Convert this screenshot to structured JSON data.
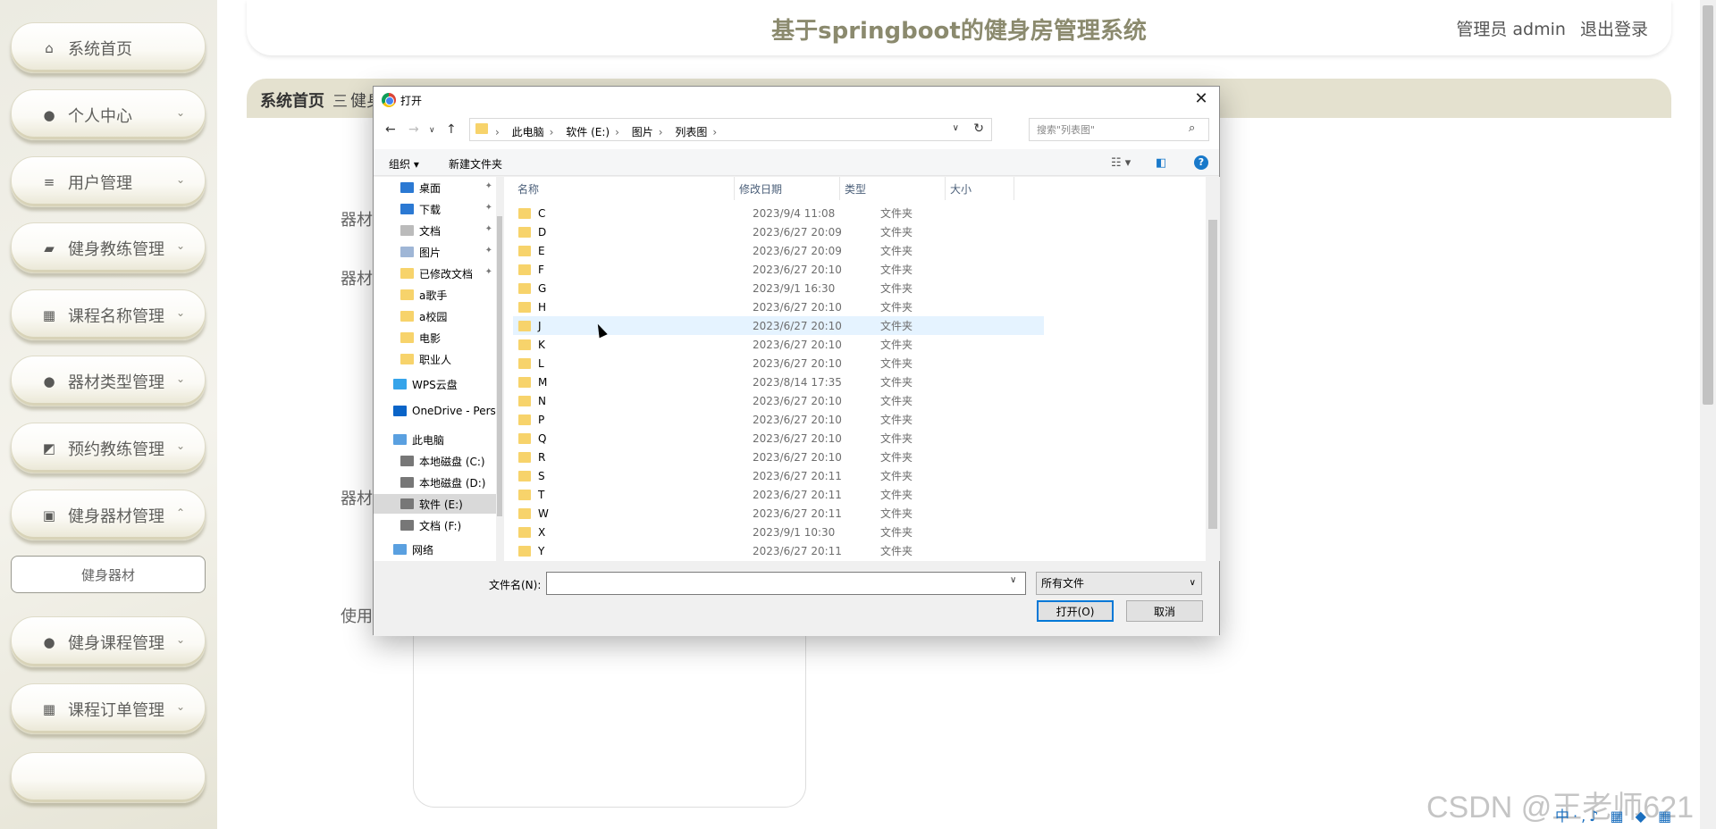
{
  "header": {
    "title": "基于springboot的健身房管理系统",
    "user": "管理员 admin",
    "logout": "退出登录"
  },
  "breadcrumb": {
    "home": "系统首页",
    "separator": "三",
    "current": "健身"
  },
  "sidebar": {
    "items": [
      {
        "label": "系统首页",
        "icon": "home-icon"
      },
      {
        "label": "个人中心",
        "icon": "user-icon"
      },
      {
        "label": "用户管理",
        "icon": "list-icon"
      },
      {
        "label": "健身教练管理",
        "icon": "briefcase-icon"
      },
      {
        "label": "课程名称管理",
        "icon": "grid-icon"
      },
      {
        "label": "器材类型管理",
        "icon": "user-icon"
      },
      {
        "label": "预约教练管理",
        "icon": "chart-icon"
      },
      {
        "label": "健身器材管理",
        "icon": "clipboard-icon"
      },
      {
        "label": "健身器材",
        "icon": ""
      },
      {
        "label": "健身课程管理",
        "icon": "bulb-icon"
      },
      {
        "label": "课程订单管理",
        "icon": "apps-icon"
      }
    ]
  },
  "form": {
    "label1": "器材",
    "label2": "器材",
    "label3": "器材",
    "label4": "使用"
  },
  "dialog": {
    "title": "打开",
    "path": [
      "此电脑",
      "软件 (E:)",
      "图片",
      "列表图"
    ],
    "search_placeholder": "搜索\"列表图\"",
    "organize": "组织 ▾",
    "new_folder": "新建文件夹",
    "help": "?",
    "nav_items": [
      {
        "label": "桌面",
        "pinned": true
      },
      {
        "label": "下载",
        "pinned": true
      },
      {
        "label": "文档",
        "pinned": true
      },
      {
        "label": "图片",
        "pinned": true
      },
      {
        "label": "已修改文档",
        "pinned": true
      },
      {
        "label": "a歌手",
        "pinned": false
      },
      {
        "label": "a校园",
        "pinned": false
      },
      {
        "label": "电影",
        "pinned": false
      },
      {
        "label": "职业人",
        "pinned": false
      },
      {
        "label": "WPS云盘",
        "pinned": false
      },
      {
        "label": "OneDrive - Pers",
        "pinned": false
      },
      {
        "label": "此电脑",
        "pinned": false
      },
      {
        "label": "本地磁盘 (C:)",
        "pinned": false
      },
      {
        "label": "本地磁盘 (D:)",
        "pinned": false
      },
      {
        "label": "软件 (E:)",
        "pinned": false
      },
      {
        "label": "文档 (F:)",
        "pinned": false
      },
      {
        "label": "网络",
        "pinned": false
      }
    ],
    "columns": [
      "名称",
      "修改日期",
      "类型",
      "大小"
    ],
    "files": [
      {
        "name": "C",
        "date": "2023/9/4 11:08",
        "type": "文件夹"
      },
      {
        "name": "D",
        "date": "2023/6/27 20:09",
        "type": "文件夹"
      },
      {
        "name": "E",
        "date": "2023/6/27 20:09",
        "type": "文件夹"
      },
      {
        "name": "F",
        "date": "2023/6/27 20:10",
        "type": "文件夹"
      },
      {
        "name": "G",
        "date": "2023/9/1 16:30",
        "type": "文件夹"
      },
      {
        "name": "H",
        "date": "2023/6/27 20:10",
        "type": "文件夹"
      },
      {
        "name": "J",
        "date": "2023/6/27 20:10",
        "type": "文件夹"
      },
      {
        "name": "K",
        "date": "2023/6/27 20:10",
        "type": "文件夹"
      },
      {
        "name": "L",
        "date": "2023/6/27 20:10",
        "type": "文件夹"
      },
      {
        "name": "M",
        "date": "2023/8/14 17:35",
        "type": "文件夹"
      },
      {
        "name": "N",
        "date": "2023/6/27 20:10",
        "type": "文件夹"
      },
      {
        "name": "P",
        "date": "2023/6/27 20:10",
        "type": "文件夹"
      },
      {
        "name": "Q",
        "date": "2023/6/27 20:10",
        "type": "文件夹"
      },
      {
        "name": "R",
        "date": "2023/6/27 20:10",
        "type": "文件夹"
      },
      {
        "name": "S",
        "date": "2023/6/27 20:11",
        "type": "文件夹"
      },
      {
        "name": "T",
        "date": "2023/6/27 20:11",
        "type": "文件夹"
      },
      {
        "name": "W",
        "date": "2023/6/27 20:11",
        "type": "文件夹"
      },
      {
        "name": "X",
        "date": "2023/9/1 10:30",
        "type": "文件夹"
      },
      {
        "name": "Y",
        "date": "2023/6/27 20:11",
        "type": "文件夹"
      }
    ],
    "filename_label": "文件名(N):",
    "filename_value": "",
    "filetype": "所有文件",
    "open_button": "打开(O)",
    "cancel_button": "取消"
  },
  "watermark": "CSDN @王老师621",
  "colors": {
    "accent": "#8b8a6e",
    "sidebar_bg": "#ecebe2",
    "crumb_bg": "#e4e1cf",
    "folder": "#f7d36b",
    "selection": "#e5f3ff"
  }
}
